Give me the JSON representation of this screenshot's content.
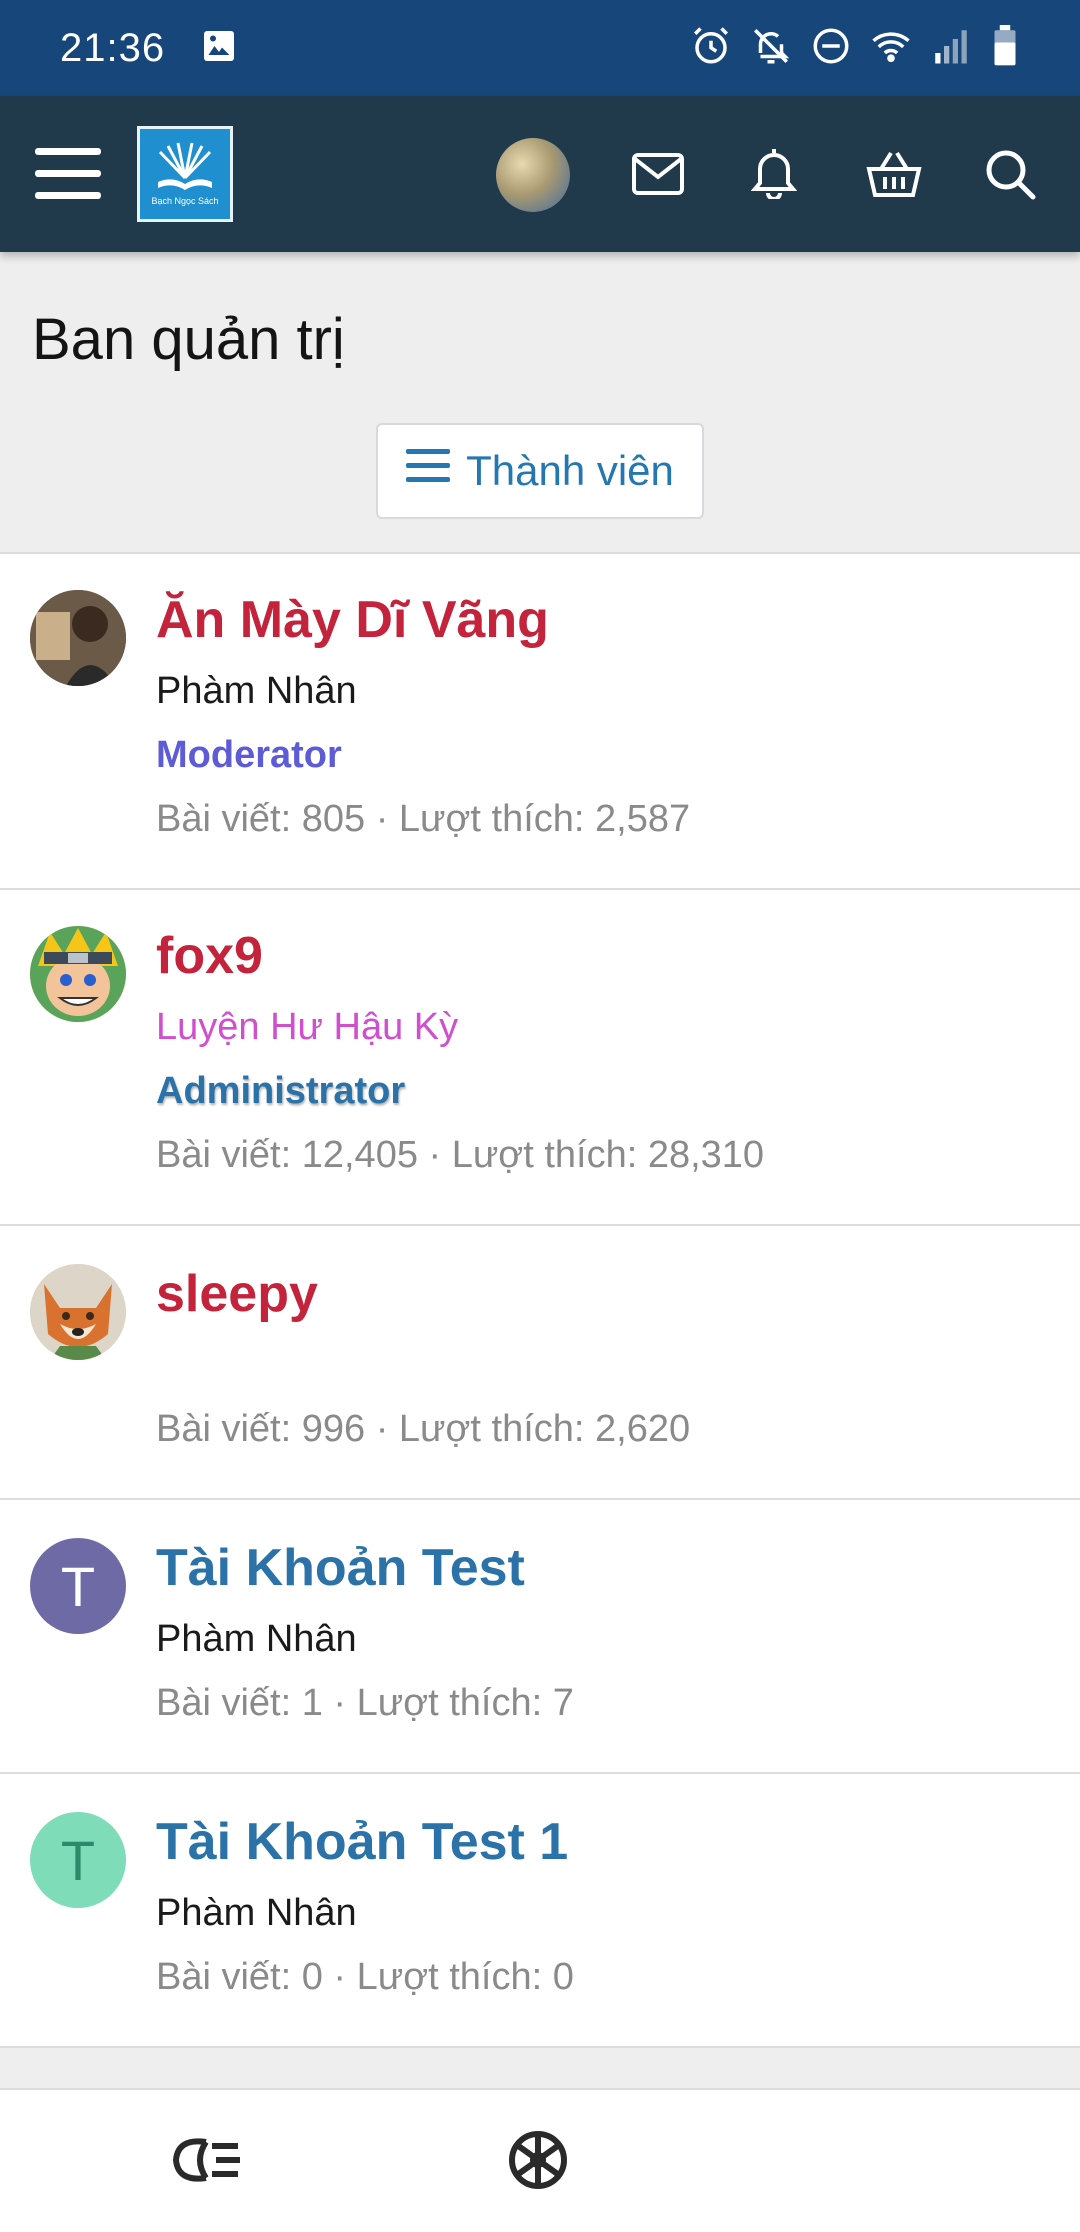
{
  "status_bar": {
    "time": "21:36",
    "icons": [
      "image-icon",
      "alarm-icon",
      "bell-off-icon",
      "do-not-disturb-icon",
      "wifi-icon",
      "signal-icon",
      "battery-icon"
    ]
  },
  "navbar": {
    "logo_text": "Bạch Ngọc Sách",
    "icons": [
      "menu-icon",
      "avatar",
      "mail-icon",
      "bell-icon",
      "basket-icon",
      "search-icon"
    ]
  },
  "page": {
    "title": "Ban quản trị",
    "members_button": "Thành viên"
  },
  "members": [
    {
      "name": "Ăn Mày Dĩ Vãng",
      "rank": "Phàm Nhân",
      "role": "Moderator",
      "stats": "Bài viết: 805 · Lượt thích: 2,587"
    },
    {
      "name": "fox9",
      "rank": "Luyện Hư Hậu Kỳ",
      "role": "Administrator",
      "stats": "Bài viết: 12,405 · Lượt thích: 28,310"
    },
    {
      "name": "sleepy",
      "stats": "Bài viết: 996 · Lượt thích: 2,620"
    },
    {
      "name": "Tài Khoản Test",
      "initial": "T",
      "rank": "Phàm Nhân",
      "stats": "Bài viết: 1 · Lượt thích: 7"
    },
    {
      "name": "Tài Khoản Test 1",
      "initial": "T",
      "rank": "Phàm Nhân",
      "stats": "Bài viết: 0 · Lượt thích: 0"
    }
  ],
  "colors": {
    "status_bar": "#16467a",
    "navbar": "#203a4c",
    "accent_blue": "#2b72a8",
    "username_red": "#c4233c",
    "avatar_purple": "#6e6aa6",
    "avatar_mint": "#7fdcb8"
  },
  "bottom_bar": {
    "icons": [
      "eye-logo-icon",
      "dharma-wheel-icon"
    ]
  }
}
